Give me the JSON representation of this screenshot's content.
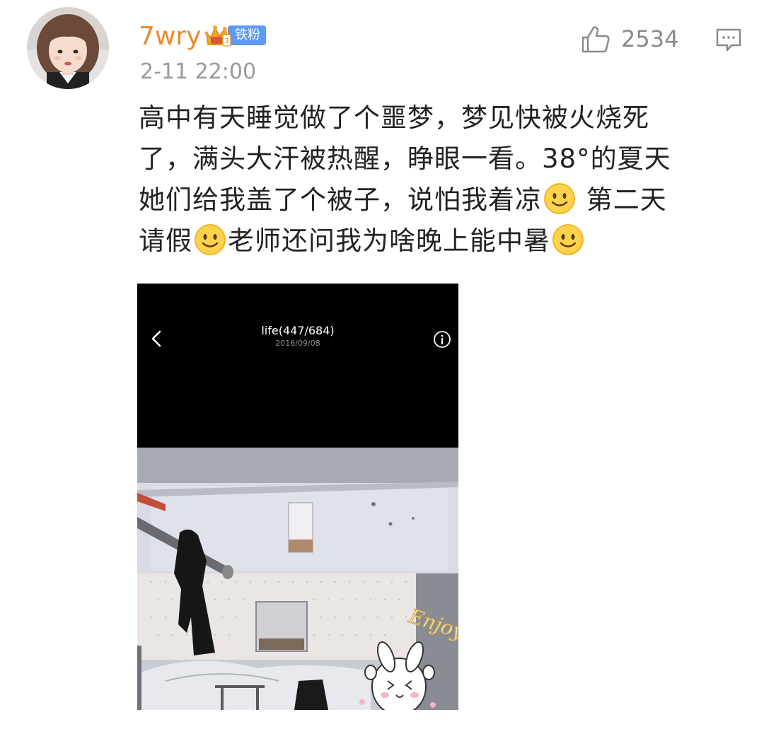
{
  "post": {
    "username": "7wry",
    "fan_badge": "铁粉",
    "timestamp": "2-11 22:00",
    "like_count": "2534",
    "content_lines": {
      "l1": "高中有天睡觉做了个噩梦，梦见快被火烧死",
      "l2": "了，满头大汗被热醒，睁眼一看。38°的夏天",
      "l3a": "她们给我盖了个被子，说怕我着凉",
      "l3b": " 第二天",
      "l4a": "请假",
      "l4b": "老师还问我为啥晚上能中暑"
    }
  },
  "photo": {
    "viewer_title": "life(447/684)",
    "viewer_date": "2016/09/08",
    "sticker_text": "Enjoy"
  },
  "icons": {
    "like": "thumbs-up-icon",
    "comment": "comment-icon",
    "emoji": "smile-emoji-icon",
    "badge": "crown-badge-icon",
    "back": "chevron-left-icon",
    "info": "info-icon"
  },
  "colors": {
    "username": "#e98a2f",
    "badge_bg": "#5d9bf2",
    "meta_gray": "#9a9a9a",
    "text": "#222222"
  }
}
